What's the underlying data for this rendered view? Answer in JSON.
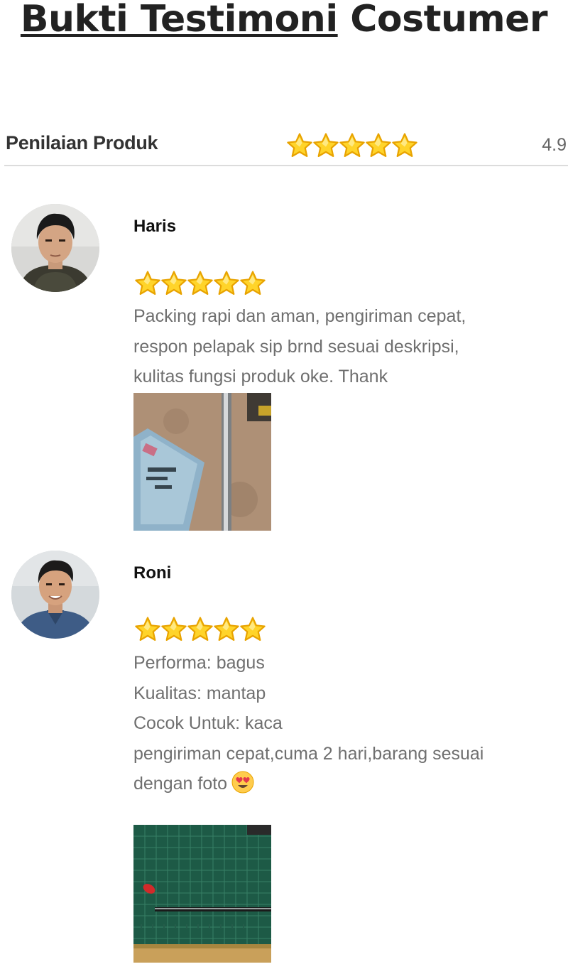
{
  "page": {
    "title_underlined": "Bukti Testimoni",
    "title_rest": "Costumer"
  },
  "rating": {
    "label": "Penilaian Produk",
    "stars": 5,
    "score": "4.9"
  },
  "reviews": [
    {
      "name": "Haris",
      "stars": 5,
      "text_lines": [
        "Packing rapi dan aman, pengiriman cepat,",
        "respon pelapak sip brnd sesuai deskripsi,",
        "kulitas fungsi produk oke. Thank"
      ],
      "photo": "product-photo"
    },
    {
      "name": "Roni",
      "stars": 5,
      "text_lines": [
        "Performa: bagus",
        "Kualitas: mantap",
        "Cocok Untuk: kaca",
        "pengiriman cepat,cuma 2 hari,barang sesuai",
        "dengan foto"
      ],
      "emoji": "heart-eyes-emoji",
      "photo": "product-photo"
    }
  ],
  "colors": {
    "star_fill": "#FFD42A",
    "star_outline": "#E8A300",
    "review_text": "#6f6f6f",
    "divider": "#dcdcdc"
  }
}
